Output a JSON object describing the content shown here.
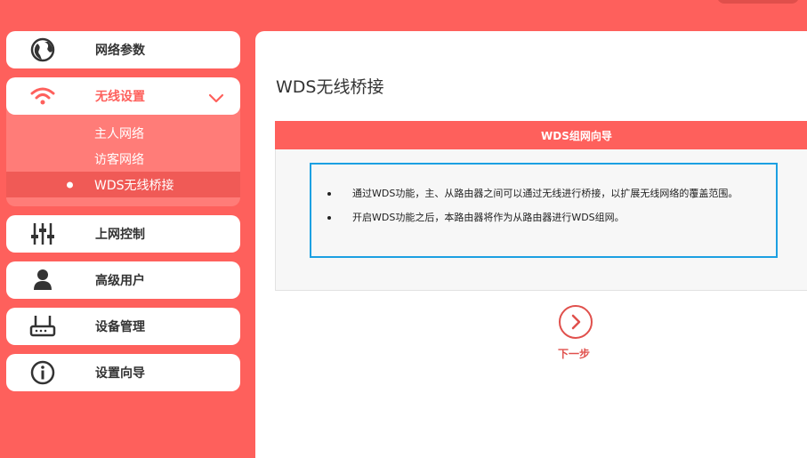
{
  "sidebar": {
    "network_params": "网络参数",
    "wireless_settings": "无线设置",
    "wireless_sub": [
      "主人网络",
      "访客网络",
      "WDS无线桥接"
    ],
    "internet_control": "上网控制",
    "advanced_user": "高级用户",
    "device_management": "设备管理",
    "setup_wizard": "设置向导"
  },
  "main": {
    "title": "WDS无线桥接",
    "wizard_header": "WDS组网向导",
    "bullets": [
      "通过WDS功能，主、从路由器之间可以通过无线进行桥接，以扩展无线网络的覆盖范围。",
      "开启WDS功能之后，本路由器将作为从路由器进行WDS组网。"
    ],
    "next_label": "下一步"
  },
  "colors": {
    "brand": "#fe605c",
    "accent_blue": "#1ca0e2",
    "submenu_bg": "#ff7c78"
  },
  "icons": [
    "globe-icon",
    "wifi-icon",
    "chevron-down-icon",
    "sliders-icon",
    "user-icon",
    "router-icon",
    "info-icon",
    "arrow-right-icon"
  ]
}
